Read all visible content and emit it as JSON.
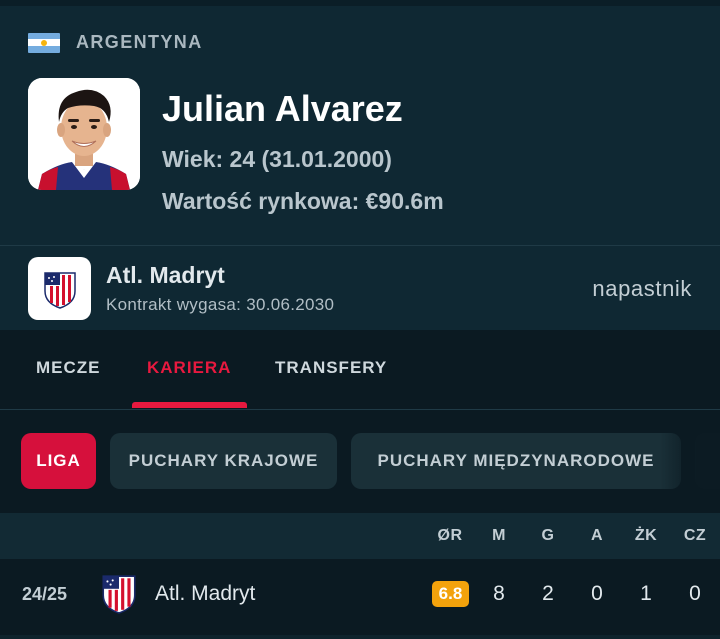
{
  "player": {
    "country": "ARGENTYNA",
    "name": "Julian Alvarez",
    "age_line": "Wiek: 24 (31.01.2000)",
    "value_line": "Wartość rynkowa: €90.6m",
    "position": "napastnik"
  },
  "club": {
    "name": "Atl. Madryt",
    "contract": "Kontrakt wygasa: 30.06.2030"
  },
  "tabs": [
    {
      "label": "MECZE",
      "active": false
    },
    {
      "label": "KARIERA",
      "active": true
    },
    {
      "label": "TRANSFERY",
      "active": false
    }
  ],
  "filters": [
    {
      "label": "LIGA",
      "active": true
    },
    {
      "label": "PUCHARY KRAJOWE",
      "active": false
    },
    {
      "label": "PUCHARY MIĘDZYNARODOWE",
      "active": false
    }
  ],
  "table": {
    "columns": [
      "ØR",
      "M",
      "G",
      "A",
      "ŻK",
      "CZ"
    ],
    "rows": [
      {
        "season": "24/25",
        "club": "Atl. Madryt",
        "rating": "6.8",
        "m": "8",
        "g": "2",
        "a": "0",
        "zk": "1",
        "cz": "0"
      }
    ]
  },
  "colors": {
    "accent": "#e8193f",
    "chip_active": "#d6103c",
    "rating_badge": "#f3a20c",
    "header_bg": "#0f2833",
    "page_bg": "#0b1a22"
  }
}
